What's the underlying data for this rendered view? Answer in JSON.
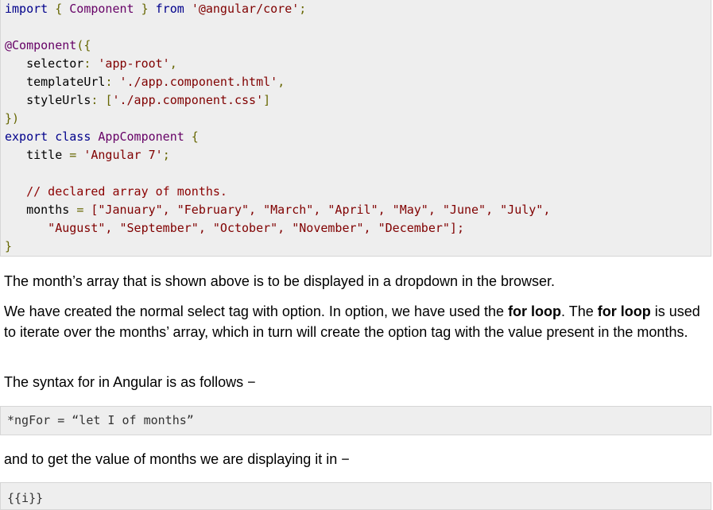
{
  "code": {
    "import_kw": "import",
    "import_open": " { ",
    "import_type": "Component",
    "import_close": " } ",
    "from_kw": "from",
    "import_str": "'@angular/core'",
    "semi": ";",
    "decorator": "@Component",
    "dec_open": "({",
    "selector_key": "   selector",
    "colon": ": ",
    "selector_val": "'app-root'",
    "comma": ",",
    "template_key": "   templateUrl",
    "template_val": "'./app.component.html'",
    "style_key": "   styleUrls",
    "style_open": "[",
    "style_val": "'./app.component.css'",
    "style_close": "]",
    "dec_close": "})",
    "export_kw": "export",
    "class_kw": " class ",
    "class_name": "AppComponent",
    "class_open": " {",
    "title_key": "   title ",
    "eq": "= ",
    "title_val": "'Angular 7'",
    "comment": "   // declared array of months.",
    "months_key": "   months ",
    "months_line1": "[\"January\", \"February\", \"March\", \"April\", \"May\", \"June\", \"July\",",
    "months_line2": "      \"August\", \"September\", \"October\", \"November\", \"December\"];",
    "class_close": "}"
  },
  "paragraphs": {
    "p1": "The month’s array that is shown above is to be displayed in a dropdown in the browser.",
    "p2_a": "We have created the normal select tag with option. In option, we have used the ",
    "p2_bold1": "for loop",
    "p2_b": ". The ",
    "p2_bold2": "for loop",
    "p2_c": " is used to iterate over the months’ array, which in turn will create the option tag with the value present in the months.",
    "p3": "The syntax for in Angular is as follows −",
    "p4": "and to get the value of months we are displaying it in −"
  },
  "snippets": {
    "ngfor": "*ngFor = “let I of months”",
    "interp": "{{i}}"
  }
}
